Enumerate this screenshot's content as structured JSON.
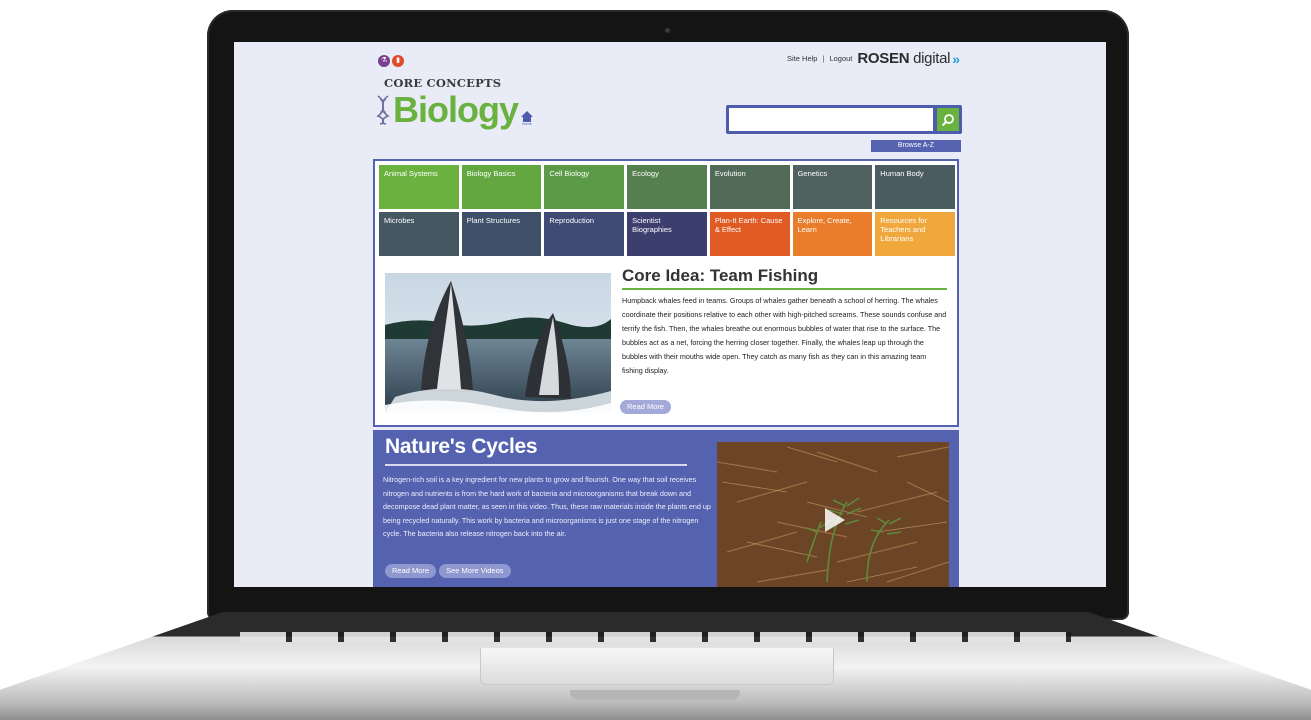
{
  "header": {
    "kicker": "CORE CONCEPTS",
    "brand": "Biology",
    "home_label": "home",
    "site_help": "Site Help",
    "separator": "|",
    "logout": "Logout",
    "rosen": "ROSEN",
    "rosen_sub": "digital",
    "rosen_arrows": "»"
  },
  "search": {
    "placeholder": "",
    "browse_label": "Browse A-Z"
  },
  "nav_tiles": [
    {
      "label": "Animal Systems",
      "color": "#6ab23f"
    },
    {
      "label": "Biology Basics",
      "color": "#62a740"
    },
    {
      "label": "Cell Biology",
      "color": "#5b9a47"
    },
    {
      "label": "Ecology",
      "color": "#557f4c"
    },
    {
      "label": "Evolution",
      "color": "#526b58"
    },
    {
      "label": "Genetics",
      "color": "#4f625f"
    },
    {
      "label": "Human Body",
      "color": "#4a5c60"
    },
    {
      "label": "Microbes",
      "color": "#455760"
    },
    {
      "label": "Plant Structures",
      "color": "#40506a"
    },
    {
      "label": "Reproduction",
      "color": "#3f4a75"
    },
    {
      "label": "Scientist Biographies",
      "color": "#3c3f6e"
    },
    {
      "label": "Plan-It Earth: Cause & Effect",
      "color": "#e05a23"
    },
    {
      "label": "Explore, Create, Learn",
      "color": "#ea7d2b"
    },
    {
      "label": "Resources for Teachers and Librarians",
      "color": "#f0a83d"
    }
  ],
  "core_idea": {
    "title": "Core Idea: Team Fishing",
    "body": "Humpback whales feed in teams. Groups of whales gather beneath a school of herring. The whales coordinate their positions relative to each other with high-pitched screams. These sounds confuse and terrify the fish. Then, the whales breathe out enormous bubbles of water that rise to the surface. The bubbles act as a net, forcing the herring closer together. Finally, the whales leap up through the bubbles with their mouths wide open. They catch as many fish as they can in this amazing team fishing display.",
    "read_more": "Read More"
  },
  "natures_cycles": {
    "title": "Nature's Cycles",
    "body": "Nitrogen-rich soil is a key ingredient for new plants to grow and flourish. One way that soil receives nitrogen and nutrients is from the hard work of bacteria and microorganisms that break down and decompose dead plant matter, as seen in this video. Thus, these raw materials inside the plants end up being recycled naturally. This work by bacteria and microorganisms is just one stage of the nitrogen cycle. The bacteria also release nitrogen back into the air.",
    "read_more": "Read More",
    "see_more": "See More Videos"
  }
}
